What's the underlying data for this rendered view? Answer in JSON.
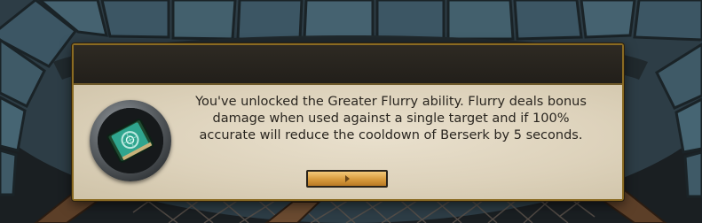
{
  "dialog": {
    "title": "",
    "message": "You've unlocked the Greater Flurry ability. Flurry deals bonus damage when used against a single target and if 100% accurate will reduce the cooldown of Berserk by 5 seconds.",
    "ability_icon": "spellbook-icon",
    "continue_icon": "arrow-right-icon"
  },
  "colors": {
    "panel_border": "#8a6b22",
    "parchment": "#e3d9c4",
    "button_gold": "#e0a648",
    "text": "#2a2620"
  }
}
